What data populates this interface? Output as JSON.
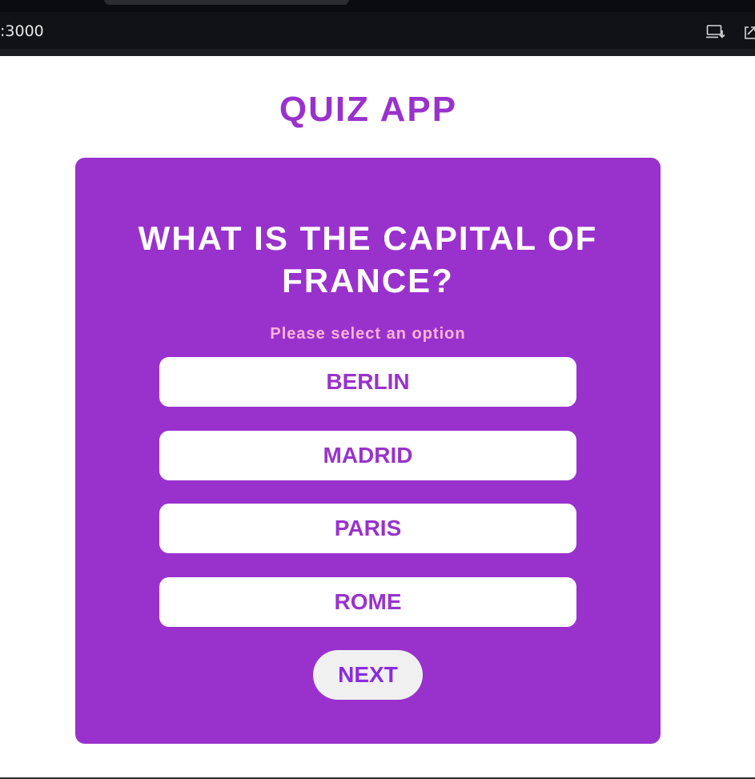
{
  "browser": {
    "address": ":3000",
    "icons": [
      "install-app-icon",
      "share-icon"
    ]
  },
  "app": {
    "title": "QUIZ APP",
    "question": "WHAT IS THE CAPITAL OF FRANCE?",
    "hint": "Please select an option",
    "options": [
      {
        "label": "BERLIN"
      },
      {
        "label": "MADRID"
      },
      {
        "label": "PARIS"
      },
      {
        "label": "ROME"
      }
    ],
    "next_label": "NEXT"
  },
  "colors": {
    "accent": "#9932cc",
    "hint": "#ffb3d9",
    "option_bg": "#ffffff",
    "next_bg": "#f0f0f0"
  }
}
